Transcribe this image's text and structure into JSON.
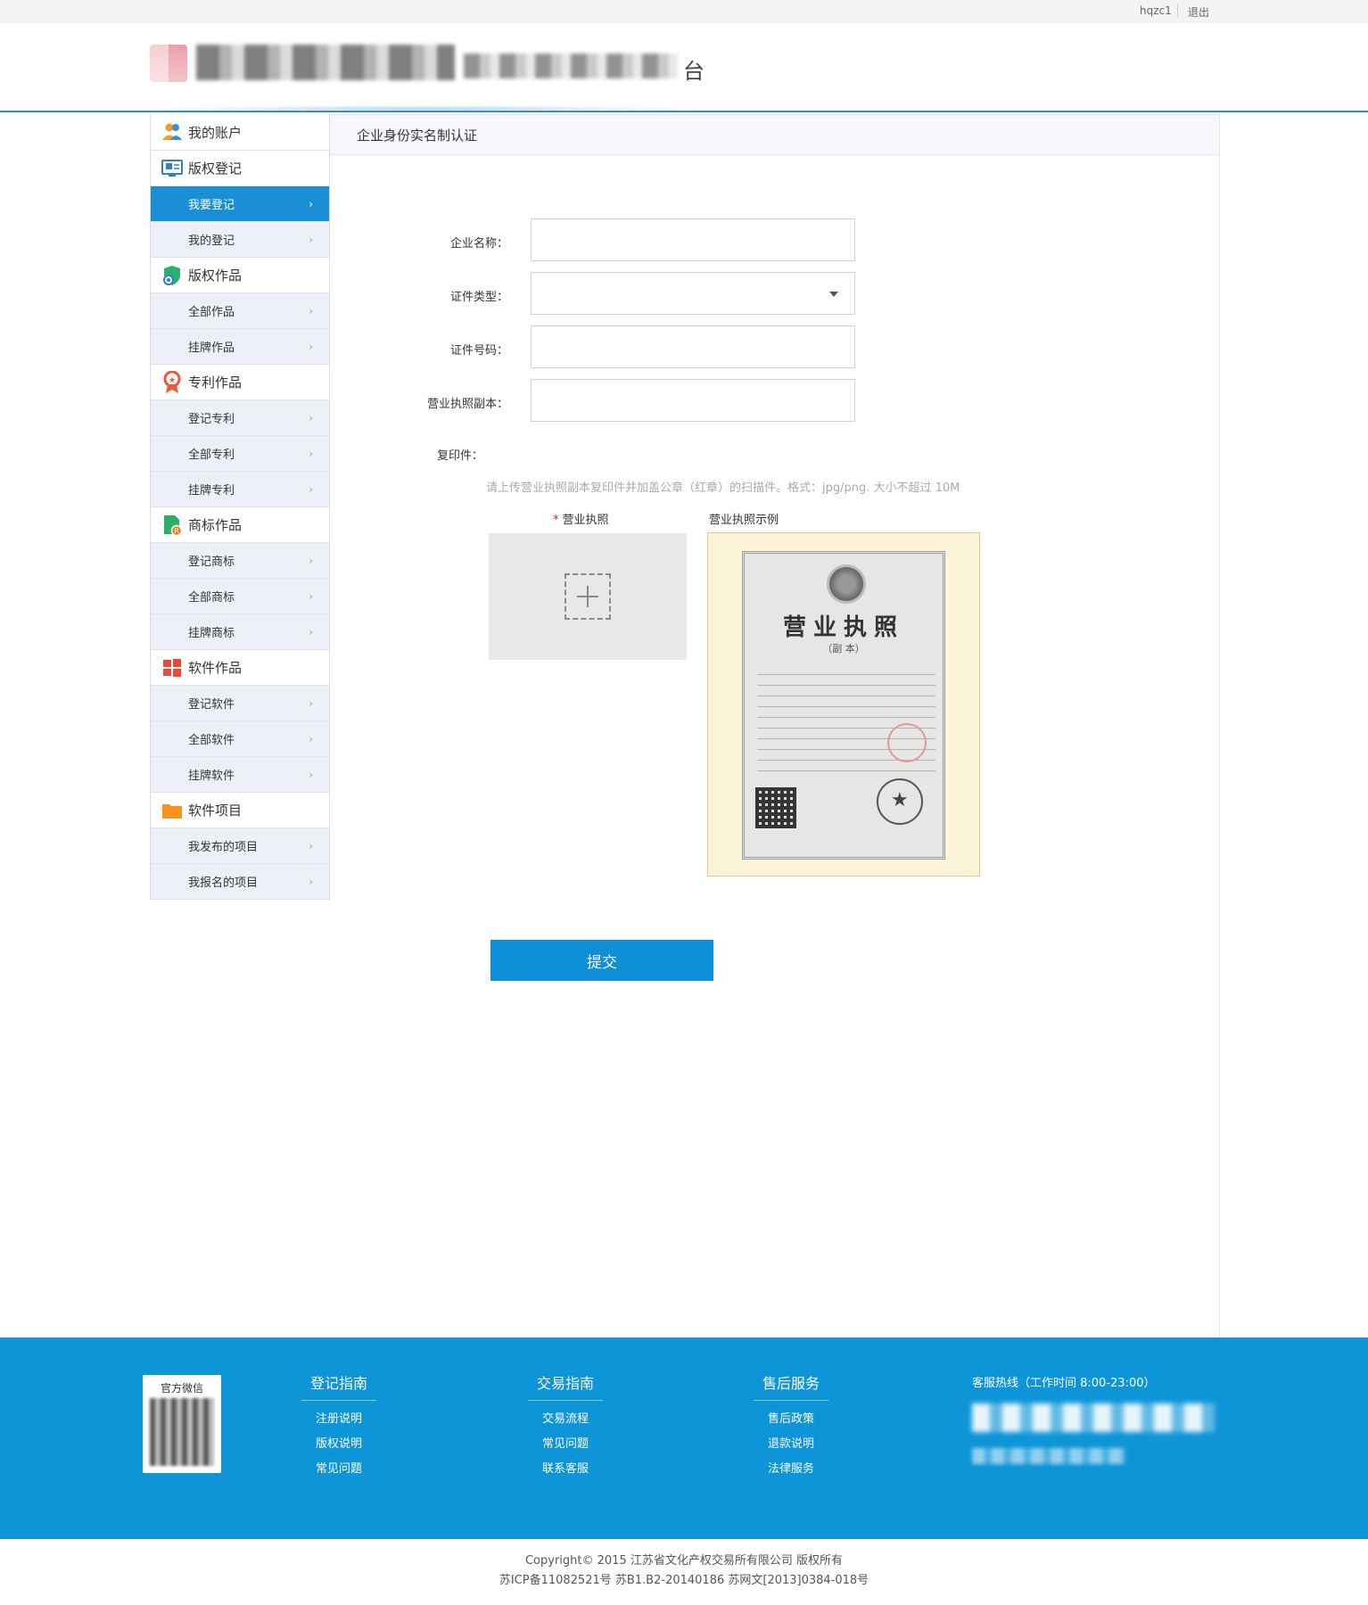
{
  "topbar": {
    "username": "hqzc1",
    "logout": "退出"
  },
  "header": {
    "logo_tail_char": "台"
  },
  "sidebar": {
    "groups": [
      {
        "label": "我的账户",
        "icon": "user-group-icon",
        "items": []
      },
      {
        "label": "版权登记",
        "icon": "register-screen-icon",
        "items": [
          "我要登记",
          "我的登记"
        ]
      },
      {
        "label": "版权作品",
        "icon": "copyright-shield-icon",
        "items": [
          "全部作品",
          "挂牌作品"
        ]
      },
      {
        "label": "专利作品",
        "icon": "patent-medal-icon",
        "items": [
          "登记专利",
          "全部专利",
          "挂牌专利"
        ]
      },
      {
        "label": "商标作品",
        "icon": "trademark-doc-icon",
        "items": [
          "登记商标",
          "全部商标",
          "挂牌商标"
        ]
      },
      {
        "label": "软件作品",
        "icon": "software-windows-icon",
        "items": [
          "登记软件",
          "全部软件",
          "挂牌软件"
        ]
      },
      {
        "label": "软件项目",
        "icon": "project-folder-icon",
        "items": [
          "我发布的项目",
          "我报名的项目"
        ]
      }
    ],
    "active_item": "我要登记"
  },
  "panel": {
    "title": "企业身份实名制认证"
  },
  "form": {
    "company_name_label": "企业名称：",
    "company_name_value": "",
    "cert_type_label": "证件类型：",
    "cert_type_value": "",
    "cert_number_label": "证件号码：",
    "cert_number_value": "",
    "license_copy_label": "营业执照副本：",
    "license_copy_value": "",
    "copy_label": "复印件：",
    "hint": "请上传营业执照副本复印件并加盖公章（红章）的扫描件。格式：jpg/png. 大小不超过 10M",
    "upload_required_mark": "*",
    "upload_label": "营业执照",
    "example_label": "营业执照示例",
    "license_title": "营业执照",
    "license_subtitle": "（副 本）",
    "submit_label": "提交"
  },
  "footer": {
    "wechat_title": "官方微信",
    "columns": [
      {
        "title": "登记指南",
        "links": [
          "注册说明",
          "版权说明",
          "常见问题"
        ]
      },
      {
        "title": "交易指南",
        "links": [
          "交易流程",
          "常见问题",
          "联系客服"
        ]
      },
      {
        "title": "售后服务",
        "links": [
          "售后政策",
          "退款说明",
          "法律服务"
        ]
      }
    ],
    "hotline_label": "客服热线（工作时间 8:00-23:00）",
    "copyright_line1": "Copyright© 2015 江苏省文化产权交易所有限公司 版权所有",
    "copyright_line2": "苏ICP备11082521号 苏B1.B2-20140186 苏网文[2013]0384-018号"
  },
  "colors": {
    "accent": "#0e8fd6",
    "footer_bg": "#0e95d8",
    "active_nav": "#1a8fd6"
  }
}
